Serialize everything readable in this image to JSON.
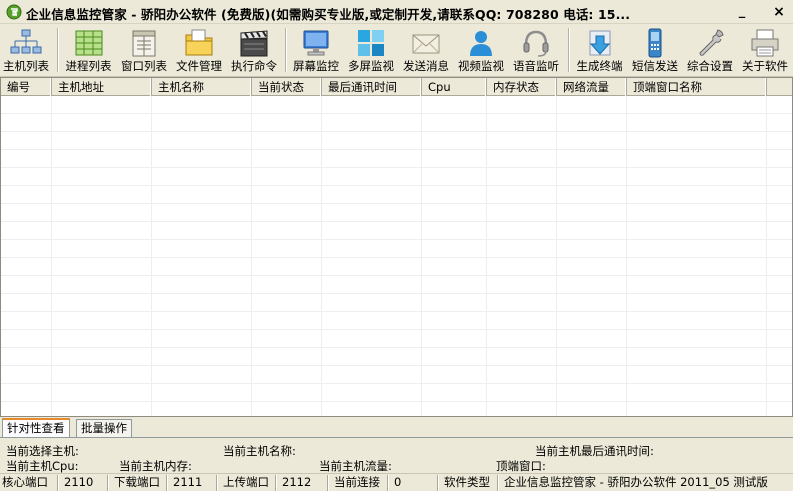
{
  "window": {
    "title": "企业信息监控管家 - 骄阳办公软件 (免费版)(如需购买专业版,或定制开发,请联系QQ: 708280 电话: 15...",
    "minimize_glyph": "_",
    "close_glyph": "×"
  },
  "toolbar": {
    "items": [
      {
        "label": "主机列表",
        "icon": "host-list-icon"
      },
      {
        "label": "进程列表",
        "icon": "process-list-icon"
      },
      {
        "label": "窗口列表",
        "icon": "window-list-icon"
      },
      {
        "label": "文件管理",
        "icon": "folder-icon"
      },
      {
        "label": "执行命令",
        "icon": "clapper-icon"
      },
      {
        "label": "屏幕监控",
        "icon": "monitor-icon"
      },
      {
        "label": "多屏监视",
        "icon": "multi-screen-icon"
      },
      {
        "label": "发送消息",
        "icon": "envelope-icon"
      },
      {
        "label": "视频监视",
        "icon": "user-icon"
      },
      {
        "label": "语音监听",
        "icon": "headset-icon"
      },
      {
        "label": "生成终端",
        "icon": "download-icon"
      },
      {
        "label": "短信发送",
        "icon": "phone-icon"
      },
      {
        "label": "综合设置",
        "icon": "wrench-icon"
      },
      {
        "label": "关于软件",
        "icon": "printer-icon"
      }
    ]
  },
  "table": {
    "columns": [
      "编号",
      "主机地址",
      "主机名称",
      "当前状态",
      "最后通讯时间",
      "Cpu",
      "内存状态",
      "网络流量",
      "顶端窗口名称"
    ],
    "rows": []
  },
  "tabs": {
    "items": [
      "针对性查看",
      "批量操作"
    ],
    "active": 0
  },
  "info_panel": {
    "current_host": "当前选择主机:",
    "host_name": "当前主机名称:",
    "last_comm": "当前主机最后通讯时间:",
    "cpu": "当前主机Cpu:",
    "memory": "当前主机内存:",
    "traffic": "当前主机流量:",
    "top_window": "顶端窗口:"
  },
  "status_bar": {
    "core_port_label": "核心端口",
    "core_port": "2110",
    "download_port_label": "下载端口",
    "download_port": "2111",
    "upload_port_label": "上传端口",
    "upload_port": "2112",
    "connections_label": "当前连接",
    "connections": "0",
    "software_type_label": "软件类型",
    "software_type": "企业信息监控管家 - 骄阳办公软件 2011_05 测试版"
  },
  "colors": {
    "window_bg": "#ECE9D8",
    "tab_accent": "#E68B2C",
    "grid_line": "#EEEEEE"
  }
}
